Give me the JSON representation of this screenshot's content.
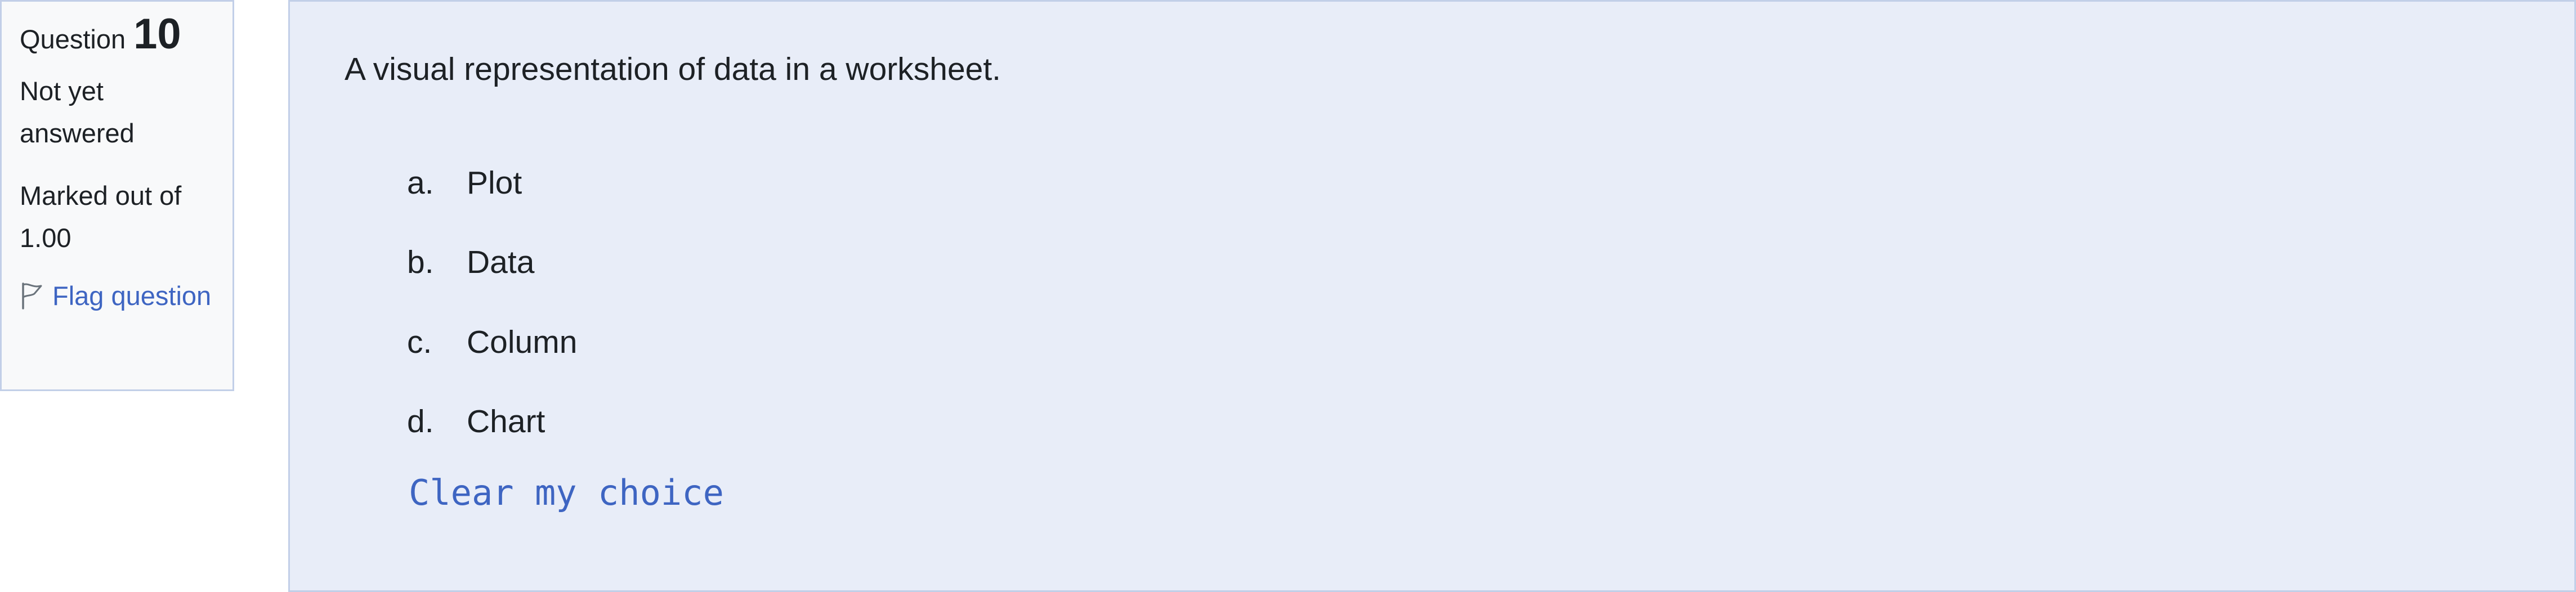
{
  "info": {
    "question_label": "Question",
    "question_number": "10",
    "state": "Not yet answered",
    "grade": "Marked out of 1.00",
    "flag_label": "Flag question",
    "flag_icon": "flag-icon"
  },
  "question": {
    "text": "A visual representation of data in a worksheet.",
    "options": [
      {
        "letter": "a.",
        "text": "Plot"
      },
      {
        "letter": "b.",
        "text": "Data"
      },
      {
        "letter": "c.",
        "text": "Column"
      },
      {
        "letter": "d.",
        "text": "Chart"
      }
    ],
    "clear_label": "Clear my choice"
  },
  "colors": {
    "info_bg": "#f8f9fa",
    "content_bg": "#e8edf8",
    "border": "#c2cfe8",
    "link": "#3e65c2",
    "text": "#1d2125"
  }
}
